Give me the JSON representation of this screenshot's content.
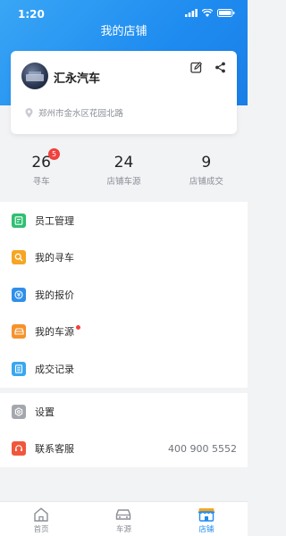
{
  "status": {
    "time": "1:20"
  },
  "page": {
    "title": "我的店铺"
  },
  "shop": {
    "name": "汇永汽车",
    "address": "郑州市金水区花园北路"
  },
  "stats": [
    {
      "value": "26",
      "label": "寻车",
      "badge": "5"
    },
    {
      "value": "24",
      "label": "店铺车源"
    },
    {
      "value": "9",
      "label": "店铺成交"
    }
  ],
  "menu": [
    {
      "label": "员工管理",
      "icon": "staff-icon",
      "color": "#2fbf71"
    },
    {
      "label": "我的寻车",
      "icon": "search-car-icon",
      "color": "#f5a623"
    },
    {
      "label": "我的报价",
      "icon": "quote-icon",
      "color": "#2f8fea"
    },
    {
      "label": "我的车源",
      "icon": "car-source-icon",
      "color": "#f5922a"
    },
    {
      "label": "成交记录",
      "icon": "record-icon",
      "color": "#3aa7f0"
    }
  ],
  "menu2": [
    {
      "label": "设置",
      "icon": "gear-icon",
      "color": "#a4a8ae"
    },
    {
      "label": "联系客服",
      "icon": "headset-icon",
      "color": "#f0573c",
      "value": "400 900 5552"
    }
  ],
  "tabs": [
    {
      "label": "首页",
      "icon": "home-icon"
    },
    {
      "label": "车源",
      "icon": "car-icon"
    },
    {
      "label": "店铺",
      "icon": "store-icon",
      "active": true
    }
  ],
  "colors": {
    "primary": "#1e8bf0",
    "badge": "#f0413d"
  }
}
